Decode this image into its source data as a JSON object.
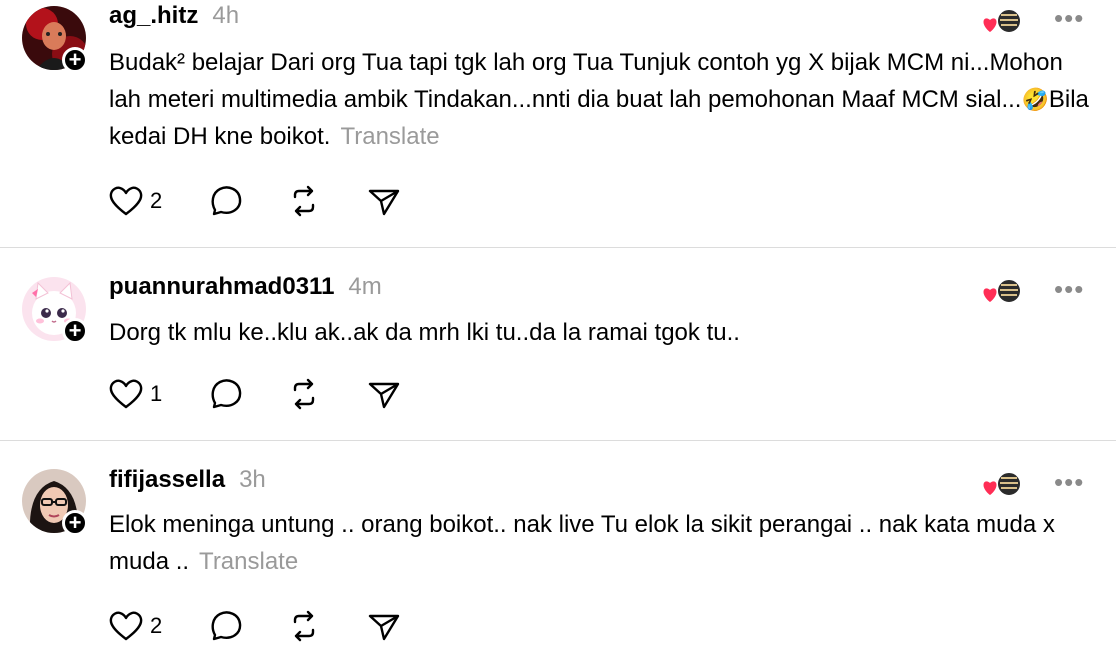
{
  "comments": [
    {
      "username": "ag_.hitz",
      "time": "4h",
      "text": "Budak² belajar Dari org Tua tapi tgk lah org Tua Tunjuk contoh yg X bijak MCM ni...Mohon lah meteri multimedia ambik Tindakan...nnti dia buat lah pemohonan Maaf MCM sial...",
      "emoji": "🤣",
      "text_after_emoji": "Bila kedai DH kne boikot.",
      "translate": "Translate",
      "likes": "2",
      "more": "•••"
    },
    {
      "username": "puannurahmad0311",
      "time": "4m",
      "text": "Dorg tk mlu ke..klu ak..ak da mrh lki tu..da la ramai tgok tu..",
      "likes": "1",
      "more": "•••"
    },
    {
      "username": "fifijassella",
      "time": "3h",
      "text": "Elok meninga untung .. orang boikot.. nak live Tu elok la sikit perangai .. nak kata muda x muda ..",
      "translate": "Translate",
      "likes": "2",
      "more": "•••"
    }
  ],
  "icons": {
    "like": "heart-outline-icon",
    "comment": "speech-bubble-icon",
    "repost": "repost-arrows-icon",
    "share": "paper-plane-icon",
    "follow": "plus-icon"
  },
  "colors": {
    "heart_red": "#ff2d55",
    "muted_gray": "#9a9a9a",
    "divider": "#dcdcdc"
  }
}
